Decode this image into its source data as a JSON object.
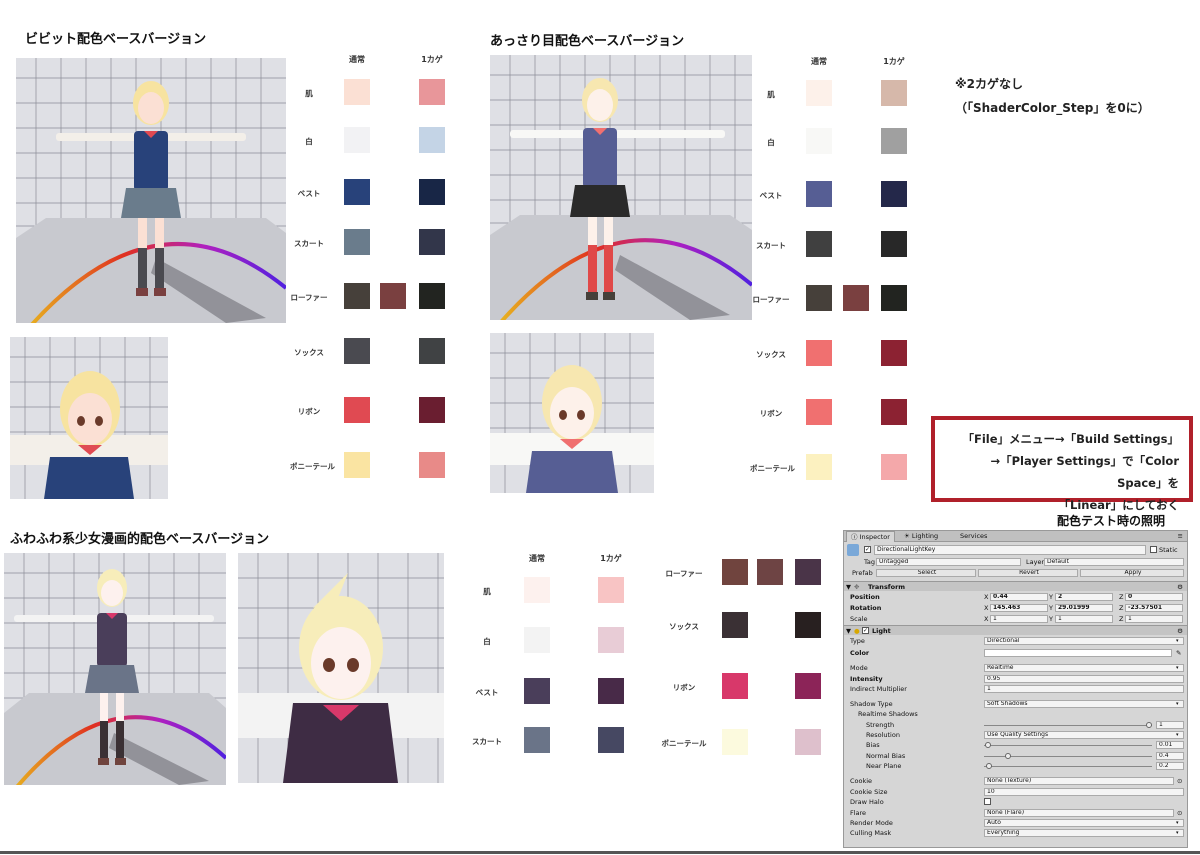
{
  "sections": {
    "vivid": {
      "title": "ビビット配色ベースバージョン",
      "col_normal": "通常",
      "col_shadow": "1カゲ",
      "rows": [
        {
          "label": "肌",
          "colors": [
            "#fbe0d4",
            "#e8969a"
          ]
        },
        {
          "label": "白",
          "colors": [
            "#f2f2f4",
            "#c4d4e6"
          ]
        },
        {
          "label": "ベスト",
          "colors": [
            "#28427a",
            "#182646"
          ]
        },
        {
          "label": "スカート",
          "colors": [
            "#6a7c8c",
            "#32364a"
          ]
        },
        {
          "label": "ローファー",
          "colors": [
            "#46403a",
            "#7a4040",
            "#222420"
          ]
        },
        {
          "label": "ソックス",
          "colors": [
            "#4a4a50",
            "#404244"
          ]
        },
        {
          "label": "リボン",
          "colors": [
            "#e04a52",
            "#6a1e30"
          ]
        },
        {
          "label": "ポニーテール",
          "colors": [
            "#fae4a2",
            "#e88a88"
          ]
        }
      ]
    },
    "light": {
      "title": "あっさり目配色ベースバージョン",
      "col_normal": "通常",
      "col_shadow": "1カゲ",
      "rows": [
        {
          "label": "肌",
          "colors": [
            "#fdf1ea",
            "#d6b8aa"
          ]
        },
        {
          "label": "白",
          "colors": [
            "#f8f8f6",
            "#a0a0a0"
          ]
        },
        {
          "label": "ベスト",
          "colors": [
            "#565e94",
            "#24284a"
          ]
        },
        {
          "label": "スカート",
          "colors": [
            "#404040",
            "#282828"
          ]
        },
        {
          "label": "ローファー",
          "colors": [
            "#46403a",
            "#7a4040",
            "#222420"
          ]
        },
        {
          "label": "ソックス",
          "colors": [
            "#f07070",
            "#8c2232"
          ]
        },
        {
          "label": "リボン",
          "colors": [
            "#f07070",
            "#8c2232"
          ]
        },
        {
          "label": "ポニーテール",
          "colors": [
            "#fcf1c0",
            "#f4a8aa"
          ]
        }
      ]
    },
    "fuwafuwa": {
      "title": "ふわふわ系少女漫画的配色ベースバージョン",
      "col_normal": "通常",
      "col_shadow": "1カゲ",
      "rows": [
        {
          "label": "肌",
          "colors": [
            "#fdf1ee",
            "#f8c4c4"
          ]
        },
        {
          "label": "白",
          "colors": [
            "#f3f3f3",
            "#e8ccd6"
          ]
        },
        {
          "label": "ベスト",
          "colors": [
            "#4a3e5a",
            "#482a48"
          ]
        },
        {
          "label": "スカート",
          "colors": [
            "#6a7488",
            "#464862"
          ]
        }
      ],
      "rows_right": [
        {
          "label": "ローファー",
          "colors": [
            "#70443e",
            "#6e4444",
            "#4a3448"
          ]
        },
        {
          "label": "ソックス",
          "colors": [
            "#3a3034",
            "#282020"
          ]
        },
        {
          "label": "リボン",
          "colors": [
            "#d8386a",
            "#8c2458"
          ]
        },
        {
          "label": "ポニーテール",
          "colors": [
            "#fcfade",
            "#dec0cc"
          ]
        }
      ]
    }
  },
  "note": {
    "line1": "※2カゲなし",
    "line2": "（「ShaderColor_Step」を0に）"
  },
  "redbox": {
    "line1": "「File」メニュー→「Build Settings」",
    "line2": "→「Player Settings」で「Color Space」を",
    "line3": "「Linear」にしておく"
  },
  "lighting_title": "配色テスト時の照明",
  "inspector": {
    "tabs": [
      "Inspector",
      "Lighting",
      "Services"
    ],
    "object_name": "DirectionalLightKey",
    "static_label": "Static",
    "tag_label": "Tag",
    "tag_value": "Untagged",
    "layer_label": "Layer",
    "layer_value": "Default",
    "prefab_label": "Prefab",
    "prefab_buttons": [
      "Select",
      "Revert",
      "Apply"
    ],
    "transform_title": "Transform",
    "position_label": "Position",
    "position": {
      "x": "0.44",
      "y": "2",
      "z": "0"
    },
    "rotation_label": "Rotation",
    "rotation": {
      "x": "145.463",
      "y": "29.01999",
      "z": "-23.57501"
    },
    "scale_label": "Scale",
    "scale": {
      "x": "1",
      "y": "1",
      "z": "1"
    },
    "light_title": "Light",
    "props": [
      {
        "label": "Type",
        "value": "Directional",
        "kind": "select"
      },
      {
        "label": "Color",
        "value": "",
        "kind": "color"
      },
      {
        "label": "Mode",
        "value": "Realtime",
        "kind": "select"
      },
      {
        "label": "Intensity",
        "value": "0.95",
        "kind": "field",
        "bold": true
      },
      {
        "label": "Indirect Multiplier",
        "value": "1",
        "kind": "field"
      },
      {
        "label": "Shadow Type",
        "value": "Soft Shadows",
        "kind": "select"
      },
      {
        "label": "Realtime Shadows",
        "value": "",
        "kind": "header"
      },
      {
        "label": "Strength",
        "value": "1",
        "kind": "slider",
        "level": 1.0
      },
      {
        "label": "Resolution",
        "value": "Use Quality Settings",
        "kind": "select"
      },
      {
        "label": "Bias",
        "value": "0.01",
        "kind": "slider",
        "level": 0.005
      },
      {
        "label": "Normal Bias",
        "value": "0.4",
        "kind": "slider",
        "level": 0.13
      },
      {
        "label": "Near Plane",
        "value": "0.2",
        "kind": "slider",
        "level": 0.01
      },
      {
        "label": "Cookie",
        "value": "None (Texture)",
        "kind": "object"
      },
      {
        "label": "Cookie Size",
        "value": "10",
        "kind": "field"
      },
      {
        "label": "Draw Halo",
        "value": "",
        "kind": "checkbox"
      },
      {
        "label": "Flare",
        "value": "None (Flare)",
        "kind": "object"
      },
      {
        "label": "Render Mode",
        "value": "Auto",
        "kind": "select"
      },
      {
        "label": "Culling Mask",
        "value": "Everything",
        "kind": "select"
      }
    ]
  }
}
